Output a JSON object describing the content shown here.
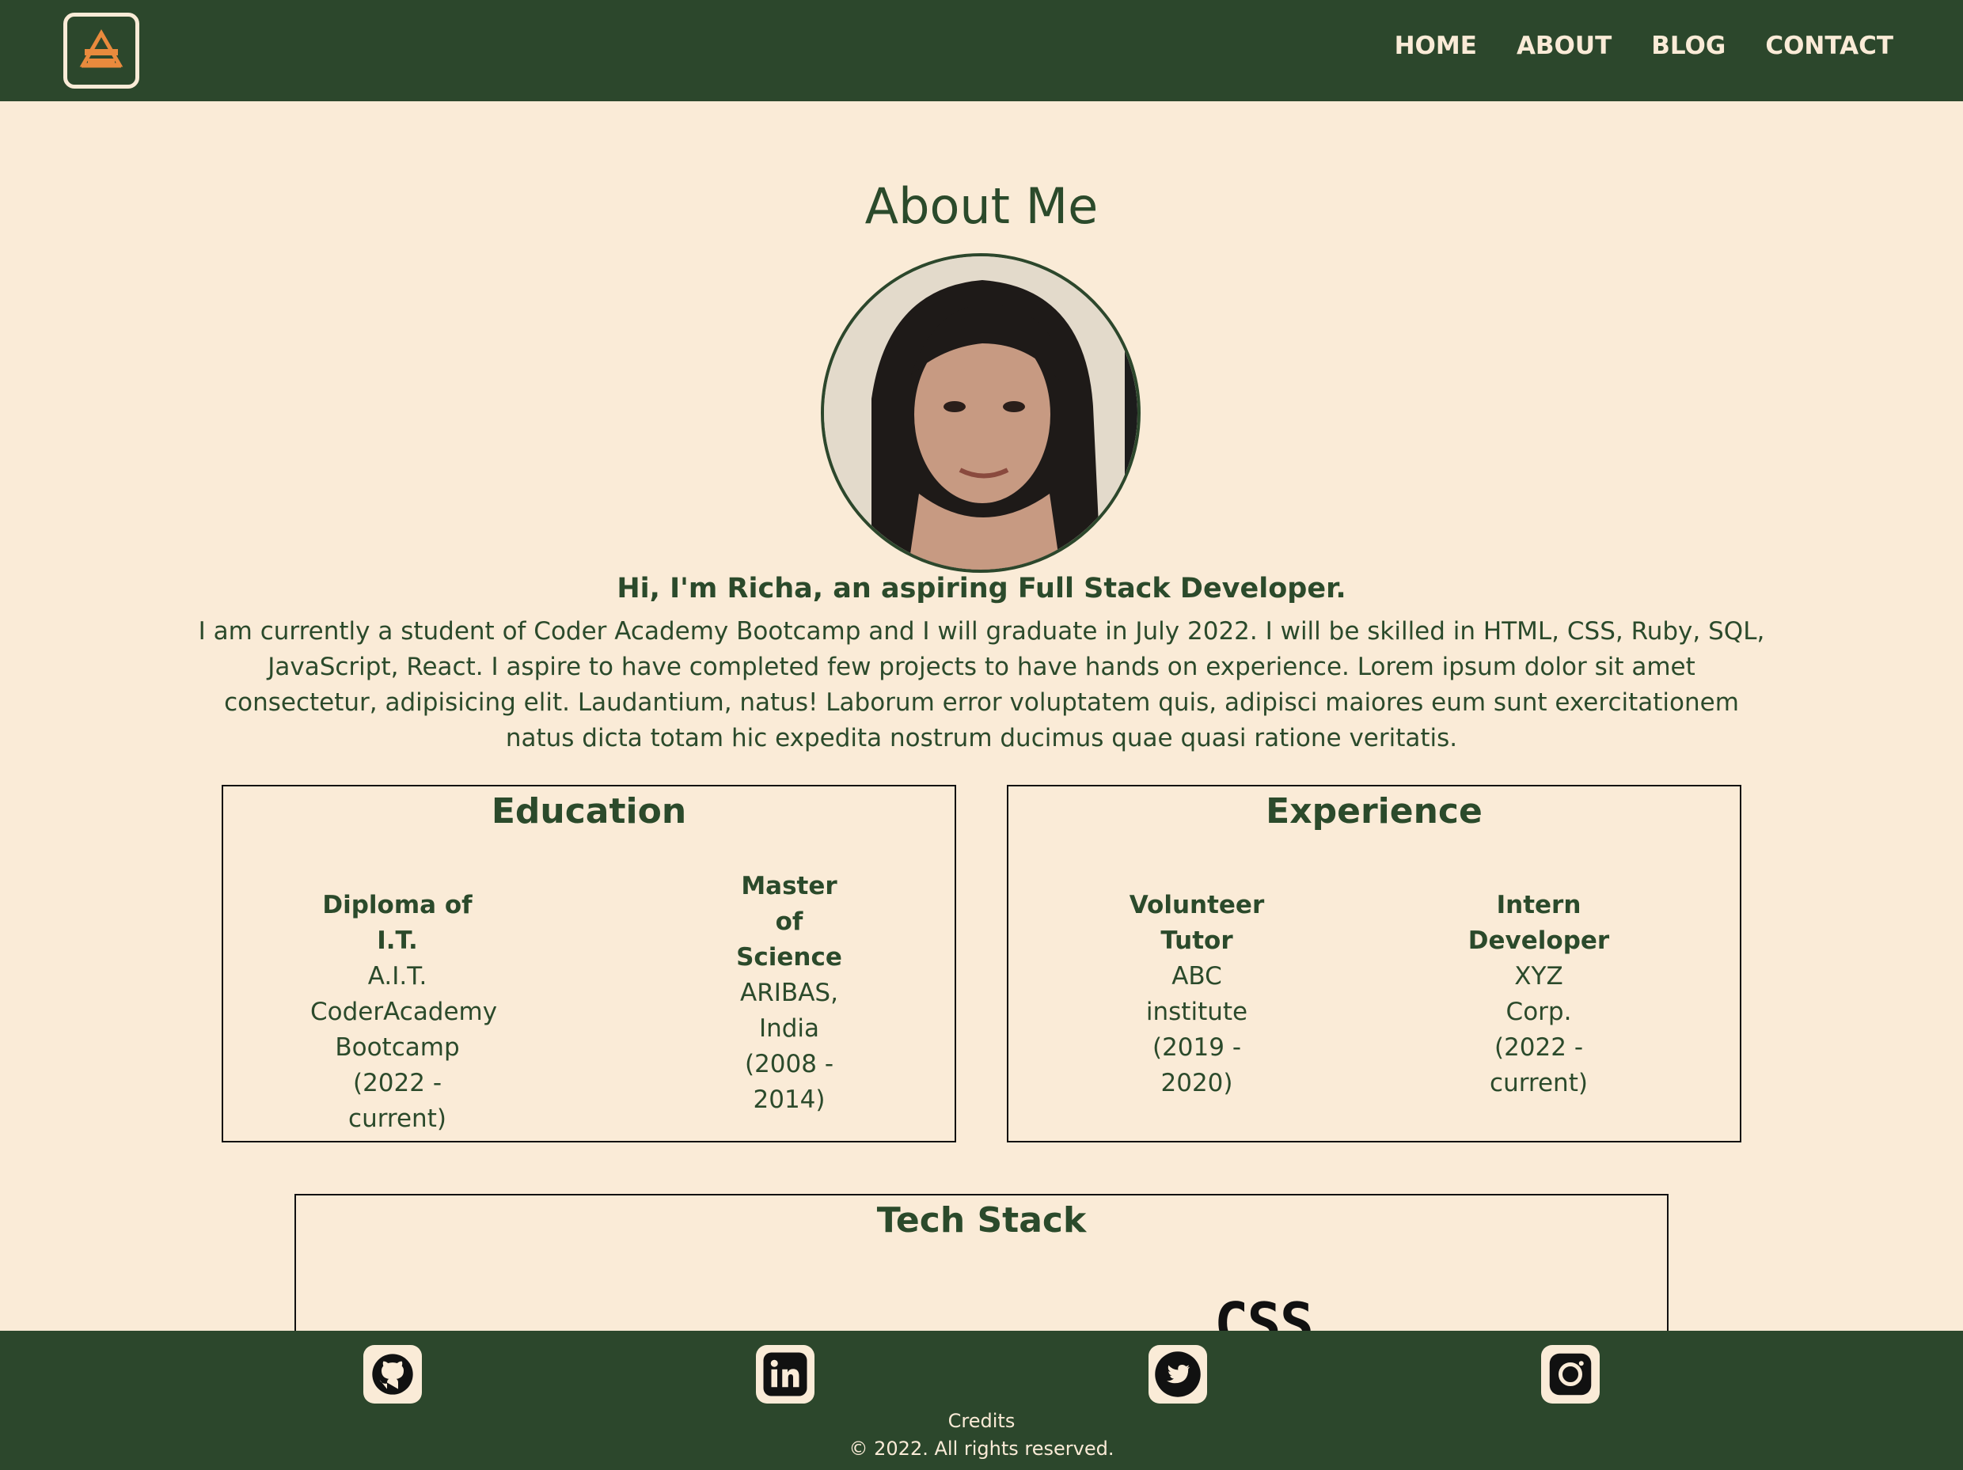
{
  "header": {
    "logo_icon": "richa-logo-icon",
    "nav": [
      "HOME",
      "ABOUT",
      "BLOG",
      "CONTACT"
    ]
  },
  "about": {
    "title": "About Me",
    "intro": "Hi, I'm Richa, an aspiring Full Stack Developer.",
    "bio": "I am currently a student of Coder Academy Bootcamp and I will graduate in July 2022. I will be skilled in HTML, CSS, Ruby, SQL, JavaScript, React. I aspire to have completed few projects to have hands on experience. Lorem ipsum dolor sit amet consectetur, adipisicing elit. Laudantium, natus! Laborum error voluptatem quis, adipisci maiores eum sunt exercitationem natus dicta totam hic expedita nostrum ducimus quae quasi ratione veritatis."
  },
  "education": {
    "title": "Education",
    "items": [
      {
        "lines_bold": [
          "Diploma of I.T."
        ],
        "lines": [
          "A.I.T.",
          "CoderAcademy",
          "Bootcamp",
          "(2022 -",
          "current)"
        ]
      },
      {
        "lines_bold": [
          "Master",
          "of",
          "Science"
        ],
        "lines": [
          "ARIBAS,",
          "India",
          "(2008 -",
          "2014)"
        ]
      }
    ]
  },
  "experience": {
    "title": "Experience",
    "items": [
      {
        "lines_bold": [
          "Volunteer",
          "Tutor"
        ],
        "lines": [
          "ABC",
          "institute",
          "(2019 -",
          "2020)"
        ]
      },
      {
        "lines_bold": [
          "Intern",
          "Developer"
        ],
        "lines": [
          "XYZ",
          "Corp.",
          "(2022 -",
          "current)"
        ]
      }
    ]
  },
  "tech_stack": {
    "title": "Tech Stack",
    "visible_logo_text": "CSS"
  },
  "footer": {
    "social_icons": [
      "github-icon",
      "linkedin-icon",
      "twitter-icon",
      "instagram-icon"
    ],
    "credits": "Credits",
    "copyright": "© 2022. All rights reserved."
  },
  "colors": {
    "background": "#FAEBD7",
    "header_footer": "#2C472C",
    "text_primary": "#2B4A2B",
    "logo_accent": "#E98A3D"
  }
}
